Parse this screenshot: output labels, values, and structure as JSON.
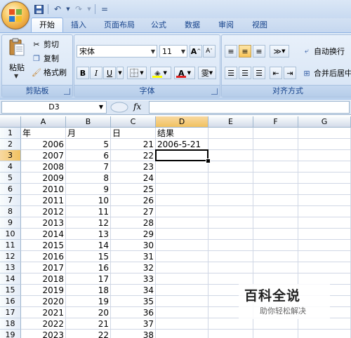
{
  "qat": {
    "menu_marker": "="
  },
  "tabs": [
    "开始",
    "插入",
    "页面布局",
    "公式",
    "数据",
    "审阅",
    "视图"
  ],
  "clipboard": {
    "paste": "粘贴",
    "cut": "剪切",
    "copy": "复制",
    "format_painter": "格式刷",
    "group": "剪贴板"
  },
  "font": {
    "name": "宋体",
    "size": "11",
    "group": "字体",
    "bold": "B",
    "italic": "I",
    "underline": "U",
    "grow": "A",
    "shrink": "A",
    "color_letter": "A",
    "phonetic": "雯"
  },
  "alignment": {
    "group": "对齐方式",
    "wrap": "自动换行",
    "merge": "合并后居中"
  },
  "formula_bar": {
    "name_box": "D3",
    "fx": "fx",
    "value": ""
  },
  "columns": [
    "A",
    "B",
    "C",
    "D",
    "E",
    "F",
    "G"
  ],
  "selected_column": "D",
  "selected_row": 3,
  "rows": [
    {
      "n": "1",
      "a": "年",
      "b": "月",
      "c": "日",
      "d": "结果"
    },
    {
      "n": "2",
      "a": "2006",
      "b": "5",
      "c": "21",
      "d": "2006-5-21"
    },
    {
      "n": "3",
      "a": "2007",
      "b": "6",
      "c": "22",
      "d": ""
    },
    {
      "n": "4",
      "a": "2008",
      "b": "7",
      "c": "23",
      "d": ""
    },
    {
      "n": "5",
      "a": "2009",
      "b": "8",
      "c": "24",
      "d": ""
    },
    {
      "n": "6",
      "a": "2010",
      "b": "9",
      "c": "25",
      "d": ""
    },
    {
      "n": "7",
      "a": "2011",
      "b": "10",
      "c": "26",
      "d": ""
    },
    {
      "n": "8",
      "a": "2012",
      "b": "11",
      "c": "27",
      "d": ""
    },
    {
      "n": "9",
      "a": "2013",
      "b": "12",
      "c": "28",
      "d": ""
    },
    {
      "n": "10",
      "a": "2014",
      "b": "13",
      "c": "29",
      "d": ""
    },
    {
      "n": "11",
      "a": "2015",
      "b": "14",
      "c": "30",
      "d": ""
    },
    {
      "n": "12",
      "a": "2016",
      "b": "15",
      "c": "31",
      "d": ""
    },
    {
      "n": "13",
      "a": "2017",
      "b": "16",
      "c": "32",
      "d": ""
    },
    {
      "n": "14",
      "a": "2018",
      "b": "17",
      "c": "33",
      "d": ""
    },
    {
      "n": "15",
      "a": "2019",
      "b": "18",
      "c": "34",
      "d": ""
    },
    {
      "n": "16",
      "a": "2020",
      "b": "19",
      "c": "35",
      "d": ""
    },
    {
      "n": "17",
      "a": "2021",
      "b": "20",
      "c": "36",
      "d": ""
    },
    {
      "n": "18",
      "a": "2022",
      "b": "21",
      "c": "37",
      "d": ""
    },
    {
      "n": "19",
      "a": "2023",
      "b": "22",
      "c": "38",
      "d": ""
    }
  ],
  "watermark": {
    "title": "百科全说",
    "subtitle": "助你轻松解决"
  }
}
